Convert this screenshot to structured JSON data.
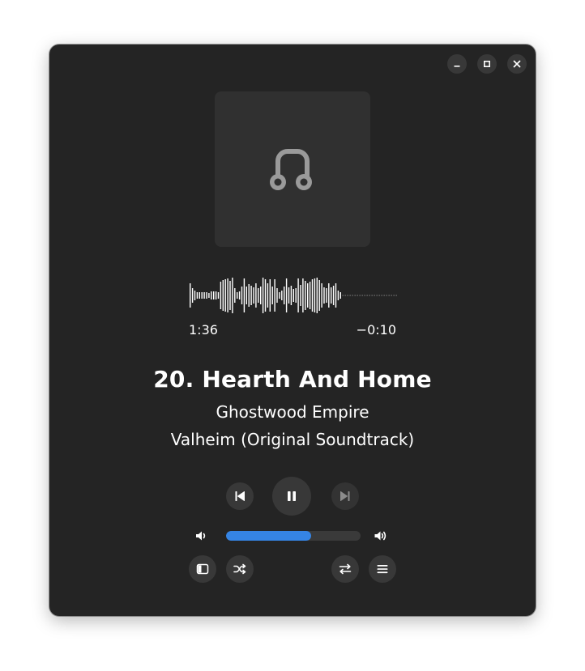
{
  "window": {
    "controls": [
      "minimize",
      "maximize",
      "close"
    ]
  },
  "cover": {
    "icon": "music-note-icon"
  },
  "playback": {
    "elapsed": "1:36",
    "remaining": "−0:10",
    "progress": 0.906
  },
  "track": {
    "title": "20. Hearth And Home",
    "artist": "Ghostwood Empire",
    "album": "Valheim (Original Soundtrack)"
  },
  "volume": {
    "level": 0.63
  },
  "colors": {
    "accent": "#3584e4",
    "window_bg": "#242424",
    "button_bg": "#383838"
  }
}
